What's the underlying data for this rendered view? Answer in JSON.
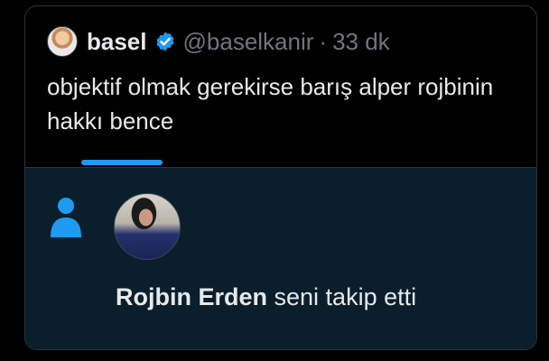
{
  "quoted_tweet": {
    "name": "basel",
    "handle": "@baselkanir",
    "separator": "·",
    "time": "33 dk",
    "text": "objektif olmak gerekirse barış alper rojbinin hakkı bence",
    "verified_icon": "verified-badge-icon",
    "avatar": "avatar"
  },
  "notification": {
    "icon": "person-icon",
    "user_name": "Rojbin Erden",
    "action_text": "seni takip etti"
  },
  "colors": {
    "background": "#000000",
    "notification_bg": "#0a1e2c",
    "accent": "#1d9bf0",
    "text": "#e7e9ea",
    "muted": "#71767b"
  }
}
